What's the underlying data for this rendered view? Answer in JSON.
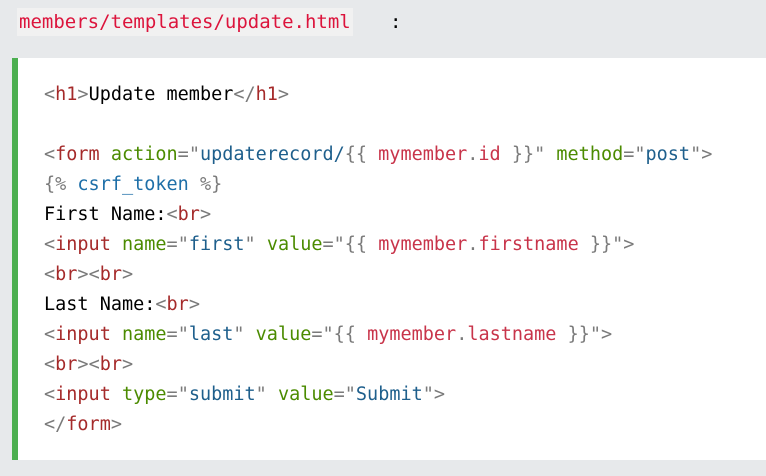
{
  "filename": "members/templates/update.html",
  "filename_suffix": ":",
  "accent_color": "#4caf50",
  "colors": {
    "tag": "#a52a2a",
    "attr": "#4b8b00",
    "string": "#1e5f8c",
    "variable": "#c8344a",
    "punctuation": "#7a7a7a"
  },
  "code_lines": [
    [
      {
        "t": "<",
        "c": "bracket"
      },
      {
        "t": "h1",
        "c": "tag"
      },
      {
        "t": ">",
        "c": "bracket"
      },
      {
        "t": "Update member",
        "c": "text"
      },
      {
        "t": "</",
        "c": "bracket"
      },
      {
        "t": "h1",
        "c": "tag"
      },
      {
        "t": ">",
        "c": "bracket"
      }
    ],
    [],
    [
      {
        "t": "<",
        "c": "bracket"
      },
      {
        "t": "form",
        "c": "tag"
      },
      {
        "t": " ",
        "c": "text"
      },
      {
        "t": "action",
        "c": "attr"
      },
      {
        "t": "=",
        "c": "eq"
      },
      {
        "t": "\"",
        "c": "quote"
      },
      {
        "t": "updaterecord/",
        "c": "value"
      },
      {
        "t": "{{ ",
        "c": "tpl"
      },
      {
        "t": "mymember",
        "c": "var"
      },
      {
        "t": ".",
        "c": "dot"
      },
      {
        "t": "id",
        "c": "var"
      },
      {
        "t": " }}",
        "c": "tpl"
      },
      {
        "t": "\"",
        "c": "quote"
      },
      {
        "t": " ",
        "c": "text"
      },
      {
        "t": "method",
        "c": "attr"
      },
      {
        "t": "=",
        "c": "eq"
      },
      {
        "t": "\"",
        "c": "quote"
      },
      {
        "t": "post",
        "c": "value"
      },
      {
        "t": "\"",
        "c": "quote"
      },
      {
        "t": ">",
        "c": "bracket"
      }
    ],
    [
      {
        "t": "{% ",
        "c": "tpl"
      },
      {
        "t": "csrf_token",
        "c": "kw"
      },
      {
        "t": " %}",
        "c": "tpl"
      }
    ],
    [
      {
        "t": "First Name:",
        "c": "text"
      },
      {
        "t": "<",
        "c": "bracket"
      },
      {
        "t": "br",
        "c": "tag"
      },
      {
        "t": ">",
        "c": "bracket"
      }
    ],
    [
      {
        "t": "<",
        "c": "bracket"
      },
      {
        "t": "input",
        "c": "tag"
      },
      {
        "t": " ",
        "c": "text"
      },
      {
        "t": "name",
        "c": "attr"
      },
      {
        "t": "=",
        "c": "eq"
      },
      {
        "t": "\"",
        "c": "quote"
      },
      {
        "t": "first",
        "c": "value"
      },
      {
        "t": "\"",
        "c": "quote"
      },
      {
        "t": " ",
        "c": "text"
      },
      {
        "t": "value",
        "c": "attr"
      },
      {
        "t": "=",
        "c": "eq"
      },
      {
        "t": "\"",
        "c": "quote"
      },
      {
        "t": "{{ ",
        "c": "tpl"
      },
      {
        "t": "mymember",
        "c": "var"
      },
      {
        "t": ".",
        "c": "dot"
      },
      {
        "t": "firstname",
        "c": "var"
      },
      {
        "t": " }}",
        "c": "tpl"
      },
      {
        "t": "\"",
        "c": "quote"
      },
      {
        "t": ">",
        "c": "bracket"
      }
    ],
    [
      {
        "t": "<",
        "c": "bracket"
      },
      {
        "t": "br",
        "c": "tag"
      },
      {
        "t": ">",
        "c": "bracket"
      },
      {
        "t": "<",
        "c": "bracket"
      },
      {
        "t": "br",
        "c": "tag"
      },
      {
        "t": ">",
        "c": "bracket"
      }
    ],
    [
      {
        "t": "Last Name:",
        "c": "text"
      },
      {
        "t": "<",
        "c": "bracket"
      },
      {
        "t": "br",
        "c": "tag"
      },
      {
        "t": ">",
        "c": "bracket"
      }
    ],
    [
      {
        "t": "<",
        "c": "bracket"
      },
      {
        "t": "input",
        "c": "tag"
      },
      {
        "t": " ",
        "c": "text"
      },
      {
        "t": "name",
        "c": "attr"
      },
      {
        "t": "=",
        "c": "eq"
      },
      {
        "t": "\"",
        "c": "quote"
      },
      {
        "t": "last",
        "c": "value"
      },
      {
        "t": "\"",
        "c": "quote"
      },
      {
        "t": " ",
        "c": "text"
      },
      {
        "t": "value",
        "c": "attr"
      },
      {
        "t": "=",
        "c": "eq"
      },
      {
        "t": "\"",
        "c": "quote"
      },
      {
        "t": "{{ ",
        "c": "tpl"
      },
      {
        "t": "mymember",
        "c": "var"
      },
      {
        "t": ".",
        "c": "dot"
      },
      {
        "t": "lastname",
        "c": "var"
      },
      {
        "t": " }}",
        "c": "tpl"
      },
      {
        "t": "\"",
        "c": "quote"
      },
      {
        "t": ">",
        "c": "bracket"
      }
    ],
    [
      {
        "t": "<",
        "c": "bracket"
      },
      {
        "t": "br",
        "c": "tag"
      },
      {
        "t": ">",
        "c": "bracket"
      },
      {
        "t": "<",
        "c": "bracket"
      },
      {
        "t": "br",
        "c": "tag"
      },
      {
        "t": ">",
        "c": "bracket"
      }
    ],
    [
      {
        "t": "<",
        "c": "bracket"
      },
      {
        "t": "input",
        "c": "tag"
      },
      {
        "t": " ",
        "c": "text"
      },
      {
        "t": "type",
        "c": "attr"
      },
      {
        "t": "=",
        "c": "eq"
      },
      {
        "t": "\"",
        "c": "quote"
      },
      {
        "t": "submit",
        "c": "value"
      },
      {
        "t": "\"",
        "c": "quote"
      },
      {
        "t": " ",
        "c": "text"
      },
      {
        "t": "value",
        "c": "attr"
      },
      {
        "t": "=",
        "c": "eq"
      },
      {
        "t": "\"",
        "c": "quote"
      },
      {
        "t": "Submit",
        "c": "value"
      },
      {
        "t": "\"",
        "c": "quote"
      },
      {
        "t": ">",
        "c": "bracket"
      }
    ],
    [
      {
        "t": "</",
        "c": "bracket"
      },
      {
        "t": "form",
        "c": "tag"
      },
      {
        "t": ">",
        "c": "bracket"
      }
    ]
  ]
}
